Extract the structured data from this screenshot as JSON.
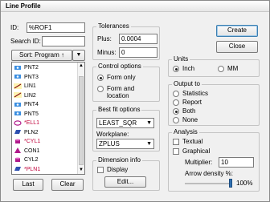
{
  "window": {
    "title": "Line Profile"
  },
  "id_field": {
    "label": "ID:",
    "value": "%ROF1"
  },
  "search_field": {
    "label": "Search ID:",
    "value": ""
  },
  "sort": {
    "label": "Sort: Program ↑",
    "menu_glyph": "▼"
  },
  "list": {
    "items": [
      {
        "name": "PNT2",
        "icon": "point-icon",
        "color": "#000000"
      },
      {
        "name": "PNT3",
        "icon": "point-icon",
        "color": "#000000"
      },
      {
        "name": "LIN1",
        "icon": "line-icon",
        "color": "#000000"
      },
      {
        "name": "LIN2",
        "icon": "line-icon",
        "color": "#000000"
      },
      {
        "name": "PNT4",
        "icon": "point-icon",
        "color": "#000000"
      },
      {
        "name": "PNT5",
        "icon": "point-icon",
        "color": "#000000"
      },
      {
        "name": "*ELL1",
        "icon": "ellipse-icon",
        "color": "#c0003a"
      },
      {
        "name": "PLN2",
        "icon": "plane-icon",
        "color": "#000000"
      },
      {
        "name": "*CYL1",
        "icon": "cylinder-icon",
        "color": "#c0003a"
      },
      {
        "name": "CON1",
        "icon": "cone-icon",
        "color": "#000000"
      },
      {
        "name": "CYL2",
        "icon": "cylinder-icon",
        "color": "#000000"
      },
      {
        "name": "*PLN1",
        "icon": "plane-icon",
        "color": "#c0003a"
      }
    ]
  },
  "buttons": {
    "last": "Last",
    "clear": "Clear",
    "create": "Create",
    "close": "Close",
    "edit": "Edit..."
  },
  "tolerances": {
    "title": "Tolerances",
    "plus_label": "Plus:",
    "plus_value": "0.0004",
    "minus_label": "Minus:",
    "minus_value": "0"
  },
  "control_options": {
    "title": "Control options",
    "form_only": "Form only",
    "form_location_1": "Form and",
    "form_location_2": "location",
    "selected": "form_only"
  },
  "best_fit": {
    "title": "Best fit options",
    "method": "LEAST_SQR",
    "workplane_label": "Workplane:",
    "workplane": "ZPLUS"
  },
  "dimension_info": {
    "title": "Dimension info",
    "display_label": "Display",
    "display_checked": false
  },
  "units": {
    "title": "Units",
    "inch": "Inch",
    "mm": "MM",
    "selected": "inch"
  },
  "output_to": {
    "title": "Output to",
    "statistics": "Statistics",
    "report": "Report",
    "both": "Both",
    "none": "None",
    "selected": "both"
  },
  "analysis": {
    "title": "Analysis",
    "textual": "Textual",
    "graphical": "Graphical",
    "multiplier_label": "Multiplier:",
    "multiplier_value": "10",
    "arrow_density_label": "Arrow density %:",
    "arrow_density_value": "100%",
    "arrow_density": 1.0
  },
  "colors": {
    "accent": "#3c7fb1",
    "highlight_red": "#c0003a",
    "arrow_blue": "#2f6fb0"
  }
}
